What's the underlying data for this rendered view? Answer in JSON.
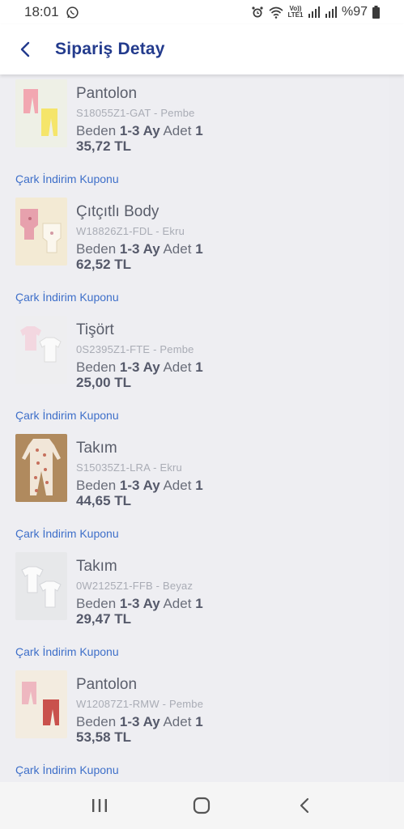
{
  "status_bar": {
    "time": "18:01",
    "battery": "%97",
    "network_label": "Vo)) LTE1"
  },
  "header": {
    "title": "Sipariş Detay"
  },
  "labels": {
    "size_prefix": "Beden",
    "qty_prefix": "Adet",
    "coupon": "Çark İndirim Kuponu"
  },
  "items": [
    {
      "name": "Pantolon",
      "code": "S18055Z1-GAT - Pembe",
      "size": "1-3 Ay",
      "qty": "1",
      "price": "35,72 TL",
      "image": "pink-yellow-pants"
    },
    {
      "name": "Çıtçıtlı Body",
      "code": "W18826Z1-FDL - Ekru",
      "size": "1-3 Ay",
      "qty": "1",
      "price": "62,52 TL",
      "image": "floral-bodysuits"
    },
    {
      "name": "Tişört",
      "code": "0S2395Z1-FTE - Pembe",
      "size": "1-3 Ay",
      "qty": "1",
      "price": "25,00 TL",
      "image": "pink-white-tshirts"
    },
    {
      "name": "Takım",
      "code": "S15035Z1-LRA - Ekru",
      "size": "1-3 Ay",
      "qty": "1",
      "price": "44,65 TL",
      "image": "patterned-jumpsuit"
    },
    {
      "name": "Takım",
      "code": "0W2125Z1-FFB - Beyaz",
      "size": "1-3 Ay",
      "qty": "1",
      "price": "29,47 TL",
      "image": "white-set"
    },
    {
      "name": "Pantolon",
      "code": "W12087Z1-RMW - Pembe",
      "size": "1-3 Ay",
      "qty": "1",
      "price": "53,58 TL",
      "image": "pink-red-pants"
    }
  ],
  "colors": {
    "title_blue": "#233b8d",
    "link_blue": "#3e6fc9",
    "text_gray": "#5a5e6b"
  }
}
